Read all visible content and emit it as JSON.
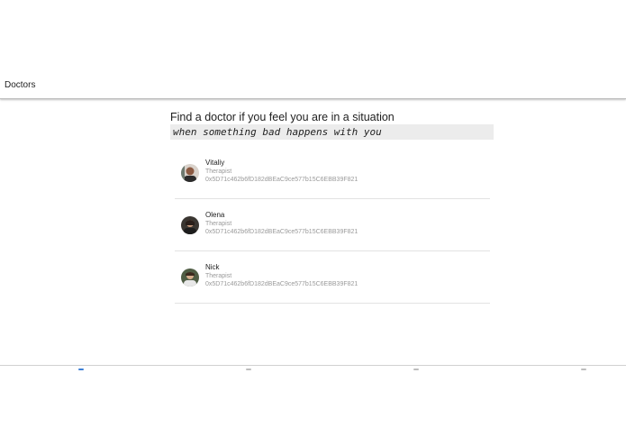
{
  "header": {
    "title": "Doctors"
  },
  "main": {
    "heading": "Find a doctor if you feel you are in a situation",
    "subheading": "when something bad happens with you"
  },
  "doctors": [
    {
      "name": "Vitaliy",
      "role": "Therapist",
      "address": "0x5D71c462b6fD182dBEaC9ce577b15C6EBB39F821"
    },
    {
      "name": "Olena",
      "role": "Therapist",
      "address": "0x5D71c462b6fD182dBEaC9ce577b15C6EBB39F821"
    },
    {
      "name": "Nick",
      "role": "Therapist",
      "address": "0x5D71c462b6fD182dBEaC9ce577b15C6EBB39F821"
    }
  ],
  "bottom_nav": {
    "tabs": [
      {
        "icon": "doctors-icon",
        "active": true
      },
      {
        "icon": "chat-icon",
        "active": false
      },
      {
        "icon": "wallet-icon",
        "active": false
      },
      {
        "icon": "profile-icon",
        "active": false
      }
    ],
    "accent": "#3d7fd6"
  }
}
